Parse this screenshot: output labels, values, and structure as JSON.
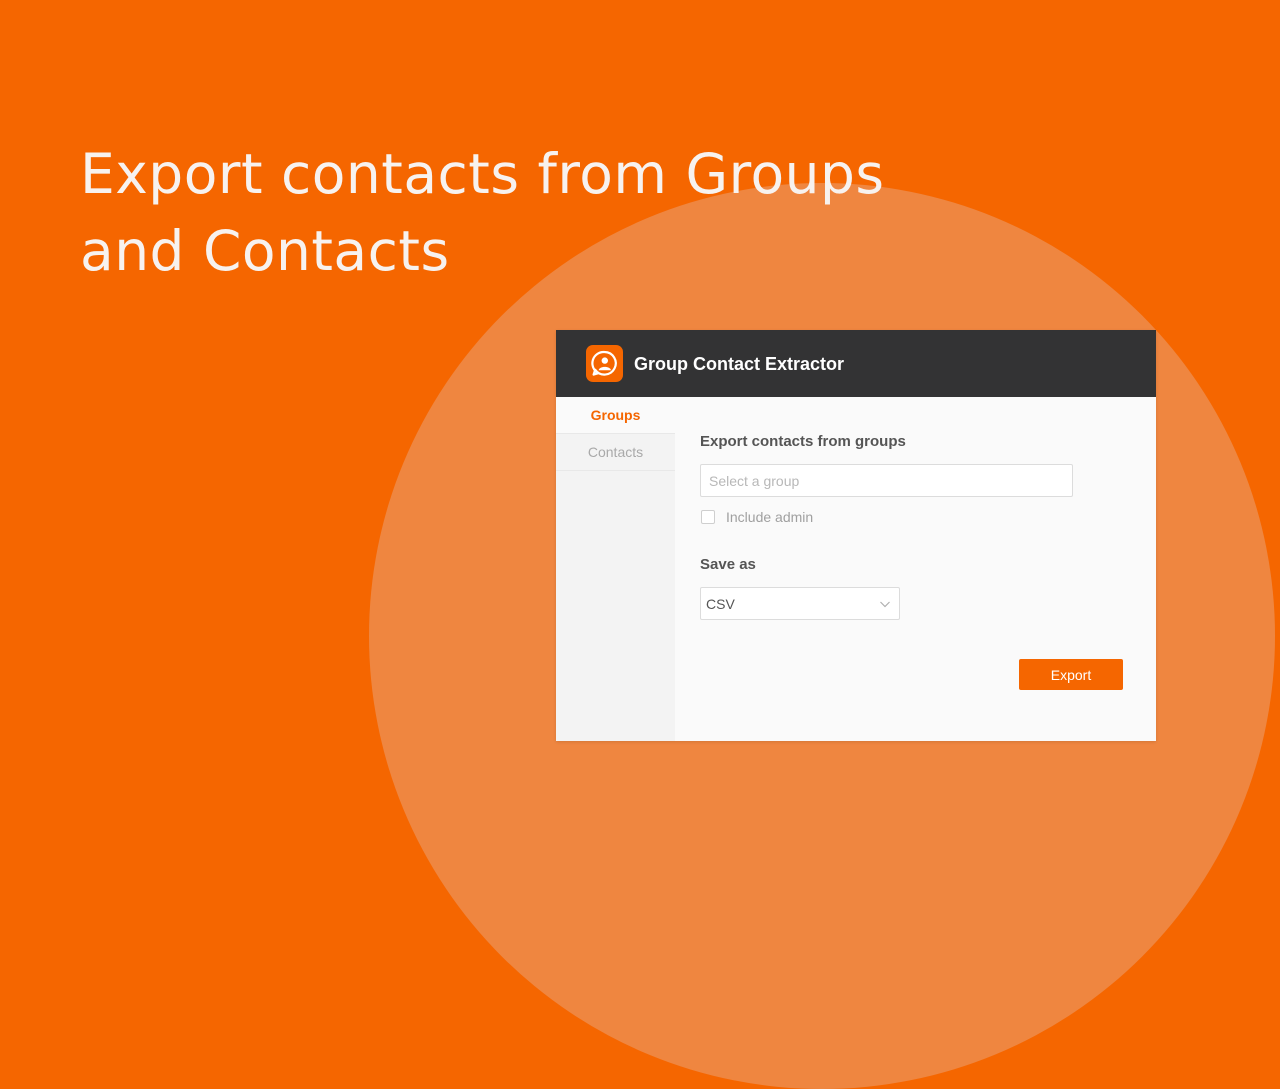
{
  "hero": {
    "line1": "Export contacts from Groups",
    "line2": "and Contacts"
  },
  "app": {
    "title": "Group Contact Extractor",
    "logo_icon": "contact-chat-bubble-icon"
  },
  "sidebar": {
    "tabs": [
      {
        "label": "Groups",
        "active": true
      },
      {
        "label": "Contacts",
        "active": false
      }
    ]
  },
  "panel": {
    "title": "Export contacts from groups",
    "group_select": {
      "placeholder": "Select a group",
      "value": ""
    },
    "include_admin": {
      "label": "Include admin",
      "checked": false
    },
    "save_as": {
      "label": "Save as",
      "value": "CSV",
      "icon": "chevron-down-icon"
    },
    "export_label": "Export"
  },
  "colors": {
    "brand_orange": "#f56600",
    "circle_orange": "#ef8640",
    "header_dark": "#333334",
    "sidebar_bg": "#f3f3f3"
  }
}
